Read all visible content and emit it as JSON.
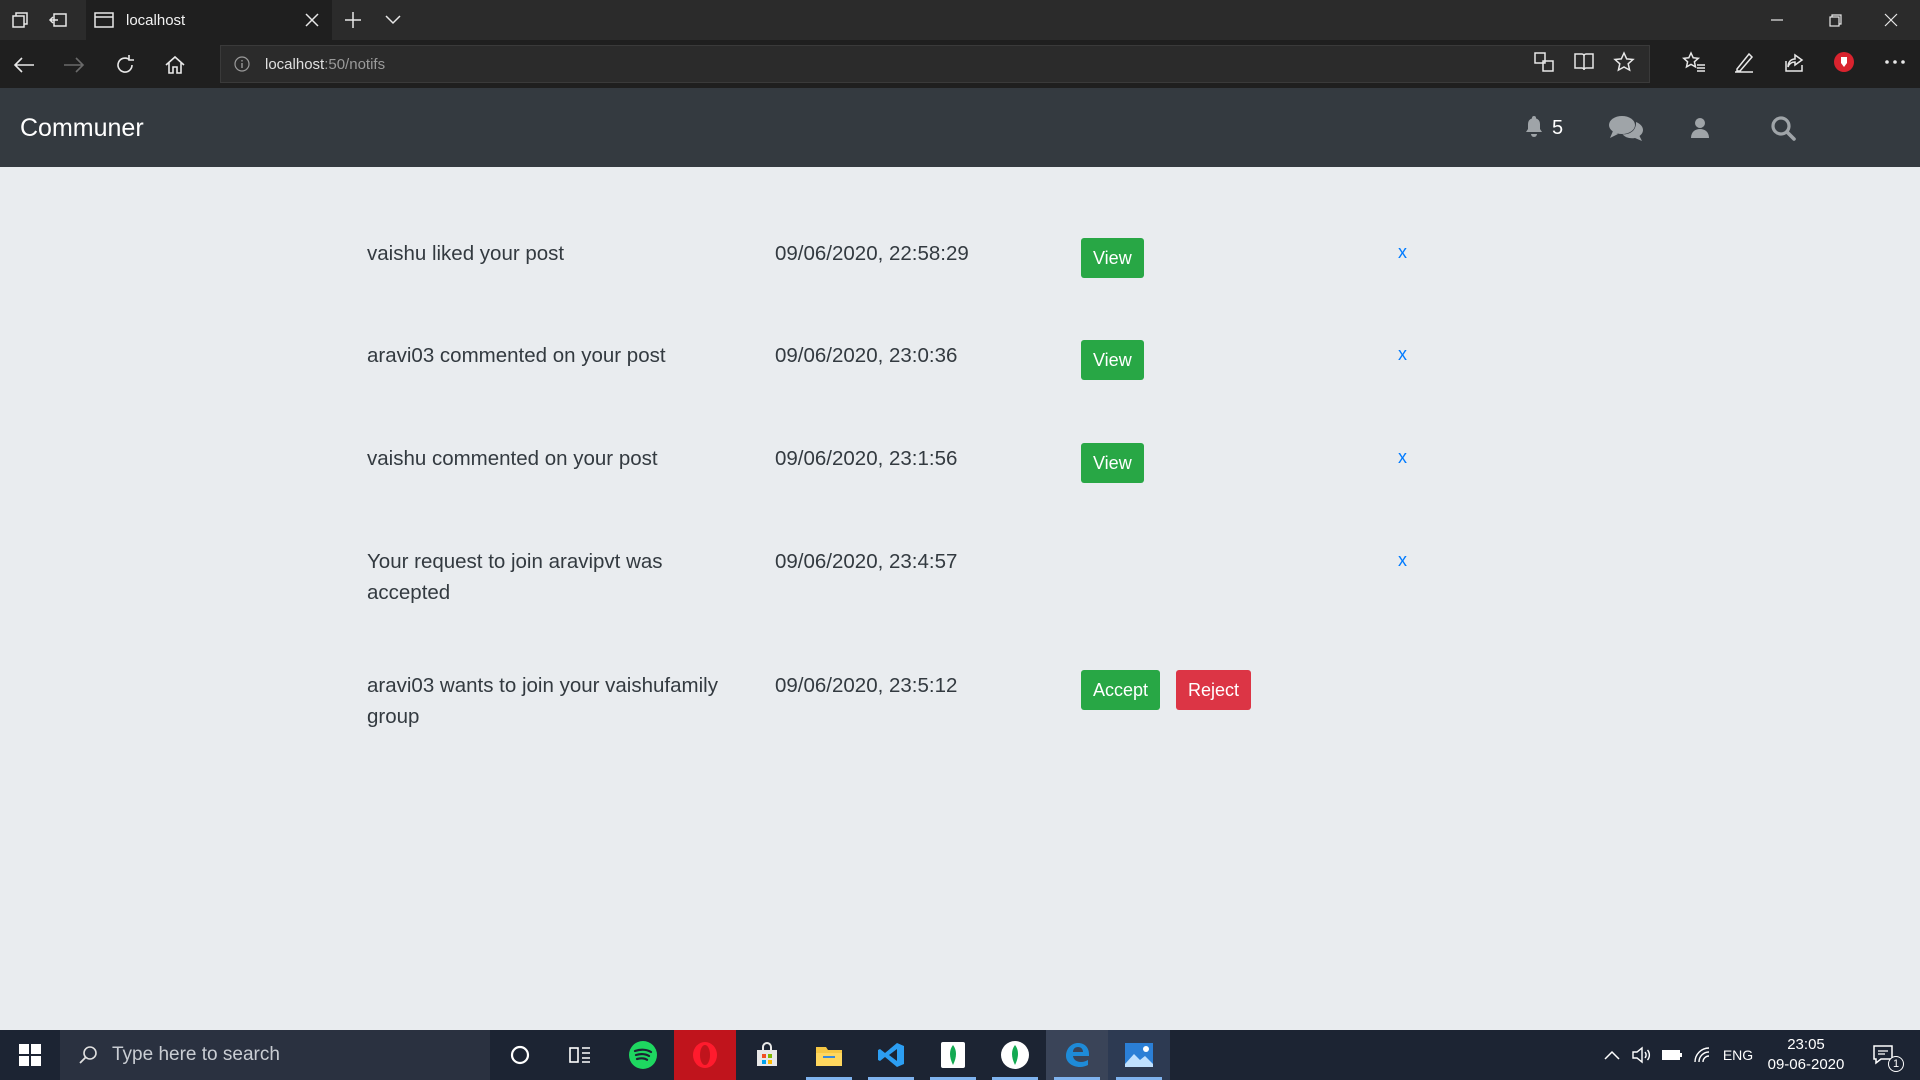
{
  "browser": {
    "tab_title": "localhost",
    "url_host": "localhost",
    "url_path": ":50/notifs"
  },
  "site": {
    "brand": "Communer",
    "notification_count": "5",
    "nav_icons": [
      "bell-icon",
      "chat-icon",
      "user-icon",
      "search-icon"
    ]
  },
  "notifications": [
    {
      "text": "vaishu liked your post",
      "time": "09/06/2020, 22:58:29",
      "action": "View",
      "dismiss": "x"
    },
    {
      "text": "aravi03 commented on your post",
      "time": "09/06/2020, 23:0:36",
      "action": "View",
      "dismiss": "x"
    },
    {
      "text": "vaishu commented on your post",
      "time": "09/06/2020, 23:1:56",
      "action": "View",
      "dismiss": "x"
    },
    {
      "text": "Your request to join aravipvt was accepted",
      "time": "09/06/2020, 23:4:57",
      "dismiss": "x"
    },
    {
      "text": "aravi03 wants to join your vaishufamily group",
      "time": "09/06/2020, 23:5:12",
      "accept": "Accept",
      "reject": "Reject"
    }
  ],
  "taskbar": {
    "search_placeholder": "Type here to search",
    "apps": [
      "cortana-icon",
      "task-view-icon",
      "spotify-icon",
      "opera-icon",
      "store-icon",
      "file-explorer-icon",
      "vscode-icon",
      "mongodb-compass-icon",
      "mongodb-icon",
      "edge-icon",
      "photos-icon"
    ],
    "language": "ENG",
    "time": "23:05",
    "date": "09-06-2020",
    "notification_badge": "1"
  },
  "colors": {
    "navbar": "#343a40",
    "page_bg": "#e9ecef",
    "success": "#28a745",
    "danger": "#dc3545",
    "link": "#007bff"
  }
}
